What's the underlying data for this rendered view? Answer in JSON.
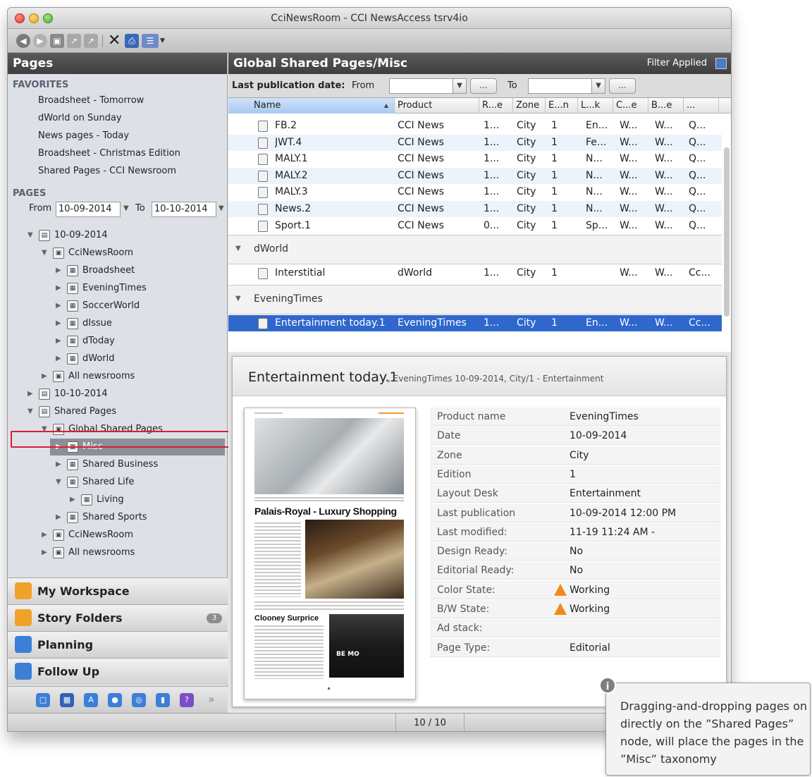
{
  "window": {
    "title": "CciNewsRoom - CCI NewsAccess tsrv4io"
  },
  "left_panel": {
    "header": "Pages",
    "favorites_header": "FAVORITES",
    "favorites": [
      "Broadsheet - Tomorrow",
      "dWorld on Sunday",
      "News pages - Today",
      "Broadsheet - Christmas Edition",
      "Shared Pages - CCI Newsroom"
    ],
    "pages_header": "PAGES",
    "range": {
      "from_label": "From",
      "from_value": "10-09-2014",
      "to_label": "To",
      "to_value": "10-10-2014"
    },
    "tree": [
      {
        "label": "10-09-2014",
        "depth": 0,
        "expanded": true
      },
      {
        "label": "CciNewsRoom",
        "depth": 1,
        "expanded": true
      },
      {
        "label": "Broadsheet",
        "depth": 2,
        "expanded": false
      },
      {
        "label": "EveningTimes",
        "depth": 2,
        "expanded": false
      },
      {
        "label": "SoccerWorld",
        "depth": 2,
        "expanded": false
      },
      {
        "label": "dIssue",
        "depth": 2,
        "expanded": false
      },
      {
        "label": "dToday",
        "depth": 2,
        "expanded": false
      },
      {
        "label": "dWorld",
        "depth": 2,
        "expanded": false
      },
      {
        "label": "All newsrooms",
        "depth": 1,
        "expanded": false
      },
      {
        "label": "10-10-2014",
        "depth": 0,
        "expanded": false
      },
      {
        "label": "Shared Pages",
        "depth": 0,
        "expanded": true
      },
      {
        "label": "Global Shared Pages",
        "depth": 1,
        "expanded": true
      },
      {
        "label": "Misc",
        "depth": 2,
        "expanded": false,
        "selected": true
      },
      {
        "label": "Shared Business",
        "depth": 2,
        "expanded": false
      },
      {
        "label": "Shared Life",
        "depth": 2,
        "expanded": true
      },
      {
        "label": "Living",
        "depth": 3,
        "expanded": false
      },
      {
        "label": "Shared Sports",
        "depth": 2,
        "expanded": false
      },
      {
        "label": "CciNewsRoom",
        "depth": 1,
        "expanded": false
      },
      {
        "label": "All newsrooms",
        "depth": 1,
        "expanded": false
      }
    ],
    "nav": [
      {
        "label": "My Workspace",
        "color": "#f0a32a"
      },
      {
        "label": "Story Folders",
        "color": "#f0a32a",
        "badge": "3"
      },
      {
        "label": "Planning",
        "color": "#3c7fd6"
      },
      {
        "label": "Follow Up",
        "color": "#3c7fd6"
      }
    ]
  },
  "main": {
    "header": "Global Shared Pages/Misc",
    "filter_applied": "Filter Applied",
    "filter": {
      "label": "Last publication date:",
      "from_label": "From",
      "to_label": "To",
      "dots": "..."
    },
    "columns": [
      "Name",
      "Product",
      "R...e",
      "Zone",
      "E...n",
      "L...k",
      "C...e",
      "B...e",
      "..."
    ],
    "rows_top": [
      [
        "FB.2",
        "CCI News",
        "1...",
        "City",
        "1",
        "En...",
        "W...",
        "W...",
        "Q..."
      ],
      [
        "JWT.4",
        "CCI News",
        "1...",
        "City",
        "1",
        "Fe...",
        "W...",
        "W...",
        "Q..."
      ],
      [
        "MALY.1",
        "CCI News",
        "1...",
        "City",
        "1",
        "N...",
        "W...",
        "W...",
        "Q..."
      ],
      [
        "MALY.2",
        "CCI News",
        "1...",
        "City",
        "1",
        "N...",
        "W...",
        "W...",
        "Q..."
      ],
      [
        "MALY.3",
        "CCI News",
        "1...",
        "City",
        "1",
        "N...",
        "W...",
        "W...",
        "Q..."
      ],
      [
        "News.2",
        "CCI News",
        "1...",
        "City",
        "1",
        "N...",
        "W...",
        "W...",
        "Q..."
      ],
      [
        "Sport.1",
        "CCI News",
        "0...",
        "City",
        "1",
        "Sp...",
        "W...",
        "W...",
        "Q..."
      ]
    ],
    "group_dworld": "dWorld",
    "row_dworld": [
      "Interstitial",
      "dWorld",
      "1...",
      "City",
      "1",
      "",
      "W...",
      "W...",
      "Cc..."
    ],
    "group_evening": "EveningTimes",
    "row_selected": [
      "Entertainment today.1",
      "EveningTimes",
      "1...",
      "City",
      "1",
      "En...",
      "W...",
      "W...",
      "Cc..."
    ]
  },
  "detail": {
    "title": "Entertainment today.1",
    "subtitle": ", EveningTimes 10-09-2014, City/1 - Entertainment",
    "thumb_headline1": "Palais-Royal - Luxury Shopping",
    "thumb_headline2": "Clooney Surprice",
    "thumb_photo_text": "BE MO",
    "properties": [
      {
        "key": "Product name",
        "value": "EveningTimes"
      },
      {
        "key": "Date",
        "value": "10-09-2014"
      },
      {
        "key": "Zone",
        "value": "City"
      },
      {
        "key": "Edition",
        "value": "1"
      },
      {
        "key": "Layout Desk",
        "value": "Entertainment"
      },
      {
        "key": "Last publication",
        "value": "10-09-2014 12:00 PM"
      },
      {
        "key": "Last modified:",
        "value": "11-19 11:24 AM -"
      },
      {
        "key": "Design Ready:",
        "value": "No"
      },
      {
        "key": "Editorial Ready:",
        "value": "No"
      },
      {
        "key": "Color State:",
        "value": "Working",
        "warn": true
      },
      {
        "key": "B/W State:",
        "value": "Working",
        "warn": true
      },
      {
        "key": "Ad stack:",
        "value": ""
      },
      {
        "key": "Page Type:",
        "value": "Editorial"
      }
    ]
  },
  "status": {
    "count": "10 / 10"
  },
  "tooltip": {
    "text": "Dragging-and-dropping pages on directly on the ”Shared Pages” node, will place the pages in the ”Misc” taxonomy"
  }
}
